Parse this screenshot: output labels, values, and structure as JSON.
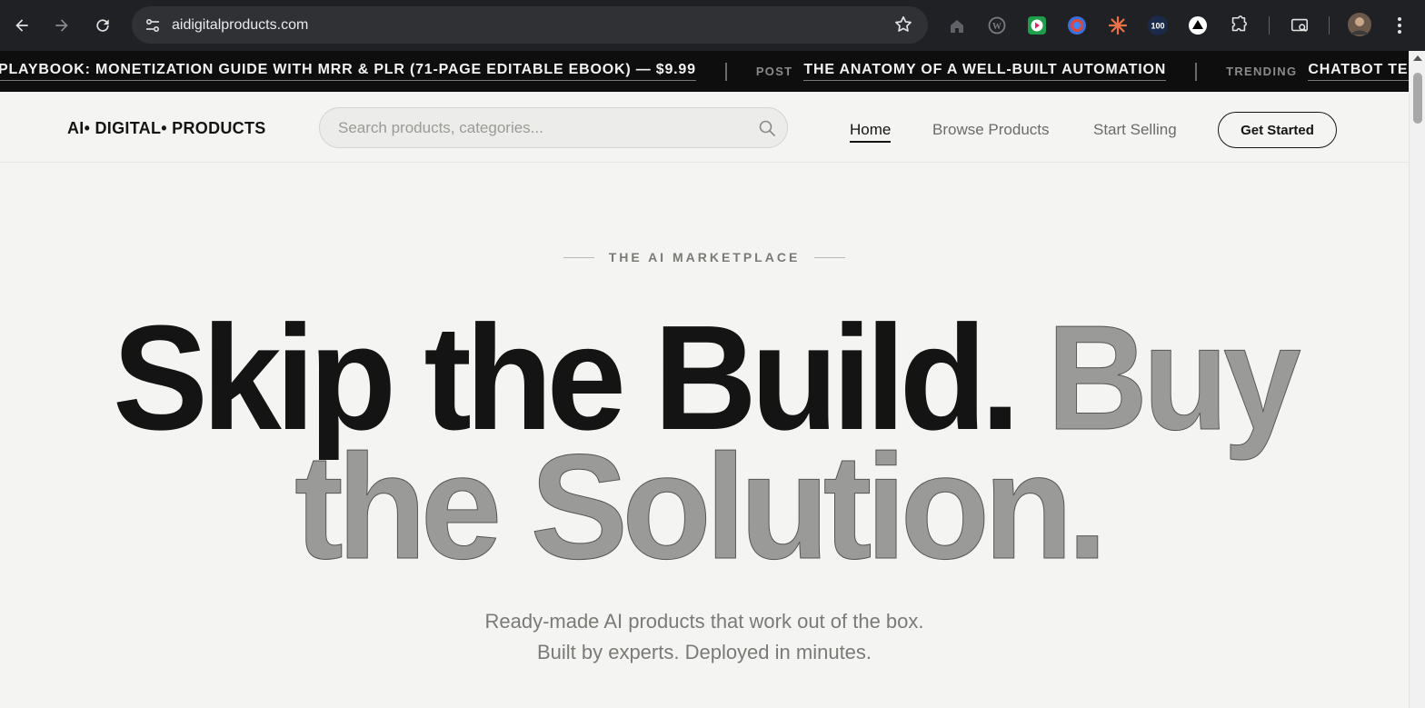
{
  "browser": {
    "url": "aidigitalproducts.com",
    "extensions": [
      "home-icon",
      "wordpress-icon",
      "green-play-icon",
      "blue-circle-icon",
      "orange-burst-icon",
      "100-badge-icon",
      "triangle-icon",
      "puzzle-icon"
    ],
    "badge_100": "100"
  },
  "ticker": {
    "items": [
      {
        "tag": "",
        "text": "PLAYBOOK: MONETIZATION GUIDE WITH MRR & PLR (71-PAGE EDITABLE EBOOK) — $9.99"
      },
      {
        "tag": "POST",
        "text": "THE ANATOMY OF A WELL-BUILT AUTOMATION"
      },
      {
        "tag": "TRENDING",
        "text": "CHATBOT TEMPL"
      }
    ]
  },
  "header": {
    "logo": "AI• DIGITAL• PRODUCTS",
    "search_placeholder": "Search products, categories...",
    "nav": [
      "Home",
      "Browse Products",
      "Start Selling"
    ],
    "cta": "Get Started"
  },
  "hero": {
    "eyebrow": "THE AI MARKETPLACE",
    "headline_dark": "Skip the Build.",
    "headline_gray_1": "Buy",
    "headline_gray_2": "the Solution.",
    "subtitle_line1": "Ready-made AI products that work out of the box.",
    "subtitle_line2": "Built by experts. Deployed in minutes.",
    "colors": {
      "dark": "#141414",
      "gray": "#9a9a98",
      "background": "#f4f4f2"
    }
  }
}
